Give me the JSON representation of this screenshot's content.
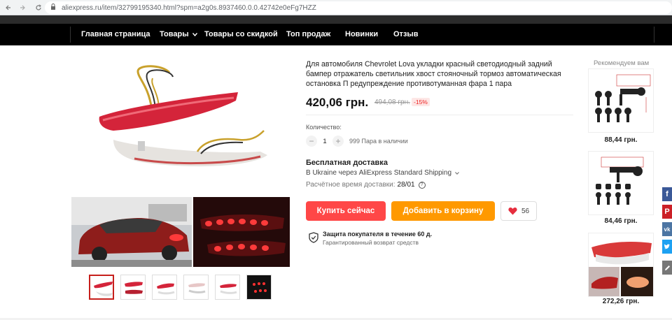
{
  "browser": {
    "url": "aliexpress.ru/item/32799195340.html?spm=a2g0s.8937460.0.0.42742e0eFg7HZZ"
  },
  "nav": {
    "items": [
      "Главная страница",
      "Товары",
      "Товары со скидкой",
      "Топ продаж",
      "Новинки",
      "Отзыв"
    ]
  },
  "product": {
    "title": "Для автомобиля Chevrolet Lova укладки красный светодиодный задний бампер отражатель светильник хвост стояночный тормоз автоматическая остановка П редупреждение противотуманная фара 1 пара",
    "price": "420,06 грн.",
    "old_price": "494,08 грн.",
    "discount": "-15%",
    "quantity_label": "Количество:",
    "quantity": "1",
    "stock": "999 Пара в наличии",
    "shipping_title": "Бесплатная доставка",
    "shipping_detail": "В Ukraine через AliExpress Standard Shipping",
    "delivery_label": "Расчётное время доставки:",
    "delivery_date": "28/01",
    "buy_label": "Купить сейчас",
    "cart_label": "Добавить в корзину",
    "wish_count": "56",
    "protection_title": "Защита покупателя в течение 60 д.",
    "protection_sub": "Гарантированный возврат средств"
  },
  "recommended": {
    "title": "Рекомендуем вам",
    "items": [
      {
        "price": "88,44 грн."
      },
      {
        "price": "84,46 грн."
      },
      {
        "price": "272,26 грн."
      }
    ]
  },
  "social": {
    "colors": [
      "#3b5998",
      "#cb2027",
      "#4c75a3",
      "#1da1f2",
      "#777777"
    ],
    "icons": [
      "facebook-icon",
      "pinterest-icon",
      "vk-icon",
      "twitter-icon",
      "edit-icon"
    ]
  },
  "colors": {
    "accent_red": "#ff4747",
    "accent_orange": "#ff9900"
  }
}
